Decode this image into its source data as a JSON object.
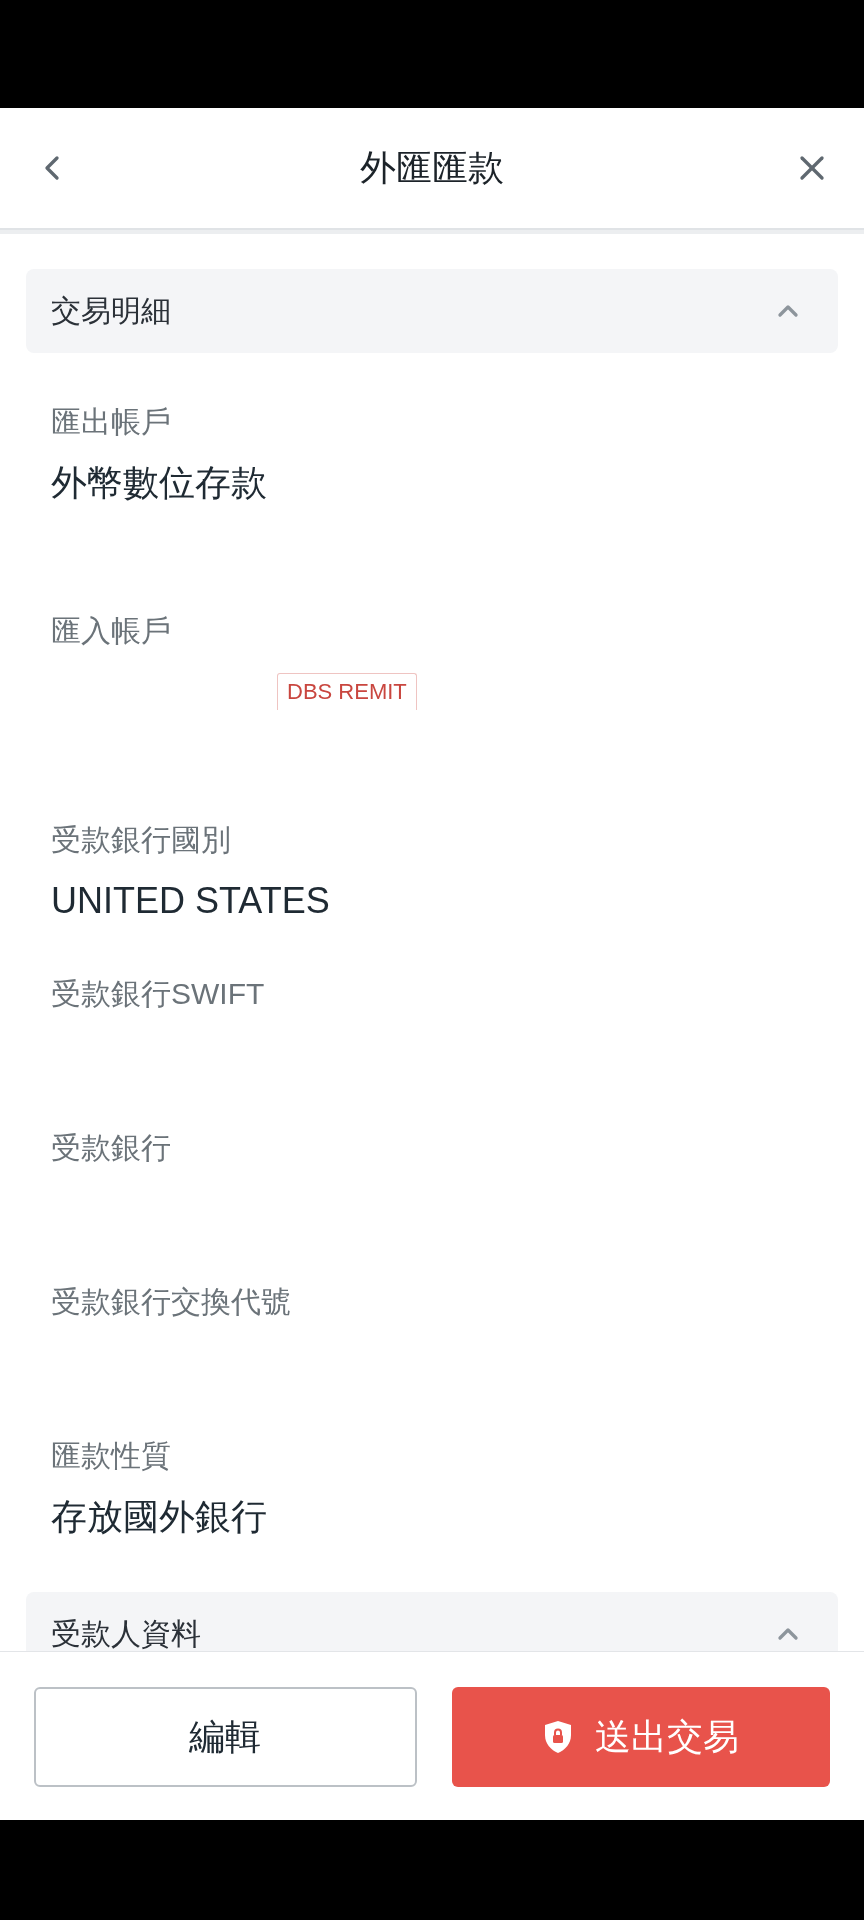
{
  "header": {
    "title": "外匯匯款"
  },
  "sections": [
    {
      "title": "交易明細",
      "expanded": true,
      "fields": [
        {
          "label": "匯出帳戶",
          "value": "外幣數位存款"
        },
        {
          "label": "匯入帳戶",
          "tag": "DBS REMIT"
        },
        {
          "label": "受款銀行國別",
          "value": "UNITED STATES"
        },
        {
          "label": "受款銀行SWIFT"
        },
        {
          "label": "受款銀行"
        },
        {
          "label": "受款銀行交換代號"
        },
        {
          "label": "匯款性質",
          "value": "存放國外銀行"
        }
      ]
    },
    {
      "title": "受款人資料",
      "expanded": true
    }
  ],
  "footer": {
    "buttons": [
      {
        "label": "編輯",
        "kind": "secondary"
      },
      {
        "label": "送出交易",
        "kind": "primary"
      }
    ]
  }
}
